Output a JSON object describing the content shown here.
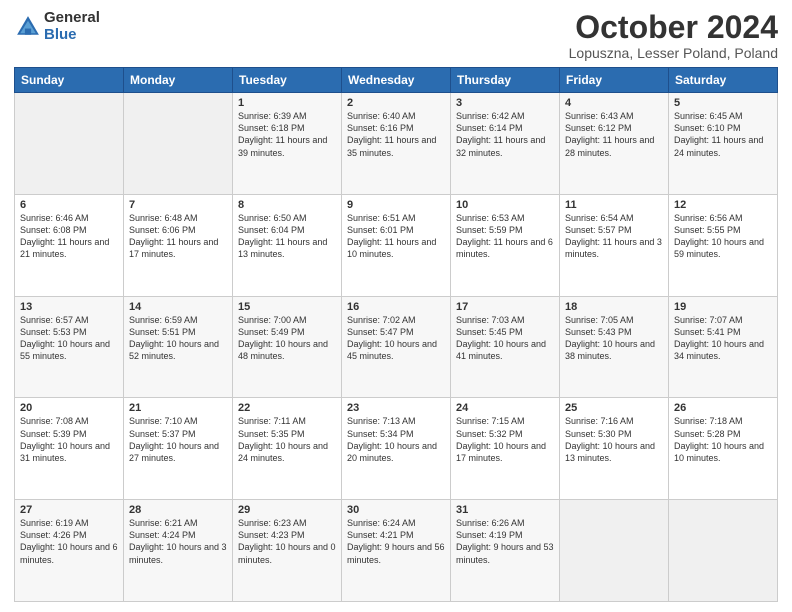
{
  "logo": {
    "general": "General",
    "blue": "Blue"
  },
  "header": {
    "title": "October 2024",
    "subtitle": "Lopuszna, Lesser Poland, Poland"
  },
  "columns": [
    "Sunday",
    "Monday",
    "Tuesday",
    "Wednesday",
    "Thursday",
    "Friday",
    "Saturday"
  ],
  "weeks": [
    [
      {
        "day": "",
        "sunrise": "",
        "sunset": "",
        "daylight": "",
        "empty": true
      },
      {
        "day": "",
        "sunrise": "",
        "sunset": "",
        "daylight": "",
        "empty": true
      },
      {
        "day": "1",
        "sunrise": "Sunrise: 6:39 AM",
        "sunset": "Sunset: 6:18 PM",
        "daylight": "Daylight: 11 hours and 39 minutes."
      },
      {
        "day": "2",
        "sunrise": "Sunrise: 6:40 AM",
        "sunset": "Sunset: 6:16 PM",
        "daylight": "Daylight: 11 hours and 35 minutes."
      },
      {
        "day": "3",
        "sunrise": "Sunrise: 6:42 AM",
        "sunset": "Sunset: 6:14 PM",
        "daylight": "Daylight: 11 hours and 32 minutes."
      },
      {
        "day": "4",
        "sunrise": "Sunrise: 6:43 AM",
        "sunset": "Sunset: 6:12 PM",
        "daylight": "Daylight: 11 hours and 28 minutes."
      },
      {
        "day": "5",
        "sunrise": "Sunrise: 6:45 AM",
        "sunset": "Sunset: 6:10 PM",
        "daylight": "Daylight: 11 hours and 24 minutes."
      }
    ],
    [
      {
        "day": "6",
        "sunrise": "Sunrise: 6:46 AM",
        "sunset": "Sunset: 6:08 PM",
        "daylight": "Daylight: 11 hours and 21 minutes."
      },
      {
        "day": "7",
        "sunrise": "Sunrise: 6:48 AM",
        "sunset": "Sunset: 6:06 PM",
        "daylight": "Daylight: 11 hours and 17 minutes."
      },
      {
        "day": "8",
        "sunrise": "Sunrise: 6:50 AM",
        "sunset": "Sunset: 6:04 PM",
        "daylight": "Daylight: 11 hours and 13 minutes."
      },
      {
        "day": "9",
        "sunrise": "Sunrise: 6:51 AM",
        "sunset": "Sunset: 6:01 PM",
        "daylight": "Daylight: 11 hours and 10 minutes."
      },
      {
        "day": "10",
        "sunrise": "Sunrise: 6:53 AM",
        "sunset": "Sunset: 5:59 PM",
        "daylight": "Daylight: 11 hours and 6 minutes."
      },
      {
        "day": "11",
        "sunrise": "Sunrise: 6:54 AM",
        "sunset": "Sunset: 5:57 PM",
        "daylight": "Daylight: 11 hours and 3 minutes."
      },
      {
        "day": "12",
        "sunrise": "Sunrise: 6:56 AM",
        "sunset": "Sunset: 5:55 PM",
        "daylight": "Daylight: 10 hours and 59 minutes."
      }
    ],
    [
      {
        "day": "13",
        "sunrise": "Sunrise: 6:57 AM",
        "sunset": "Sunset: 5:53 PM",
        "daylight": "Daylight: 10 hours and 55 minutes."
      },
      {
        "day": "14",
        "sunrise": "Sunrise: 6:59 AM",
        "sunset": "Sunset: 5:51 PM",
        "daylight": "Daylight: 10 hours and 52 minutes."
      },
      {
        "day": "15",
        "sunrise": "Sunrise: 7:00 AM",
        "sunset": "Sunset: 5:49 PM",
        "daylight": "Daylight: 10 hours and 48 minutes."
      },
      {
        "day": "16",
        "sunrise": "Sunrise: 7:02 AM",
        "sunset": "Sunset: 5:47 PM",
        "daylight": "Daylight: 10 hours and 45 minutes."
      },
      {
        "day": "17",
        "sunrise": "Sunrise: 7:03 AM",
        "sunset": "Sunset: 5:45 PM",
        "daylight": "Daylight: 10 hours and 41 minutes."
      },
      {
        "day": "18",
        "sunrise": "Sunrise: 7:05 AM",
        "sunset": "Sunset: 5:43 PM",
        "daylight": "Daylight: 10 hours and 38 minutes."
      },
      {
        "day": "19",
        "sunrise": "Sunrise: 7:07 AM",
        "sunset": "Sunset: 5:41 PM",
        "daylight": "Daylight: 10 hours and 34 minutes."
      }
    ],
    [
      {
        "day": "20",
        "sunrise": "Sunrise: 7:08 AM",
        "sunset": "Sunset: 5:39 PM",
        "daylight": "Daylight: 10 hours and 31 minutes."
      },
      {
        "day": "21",
        "sunrise": "Sunrise: 7:10 AM",
        "sunset": "Sunset: 5:37 PM",
        "daylight": "Daylight: 10 hours and 27 minutes."
      },
      {
        "day": "22",
        "sunrise": "Sunrise: 7:11 AM",
        "sunset": "Sunset: 5:35 PM",
        "daylight": "Daylight: 10 hours and 24 minutes."
      },
      {
        "day": "23",
        "sunrise": "Sunrise: 7:13 AM",
        "sunset": "Sunset: 5:34 PM",
        "daylight": "Daylight: 10 hours and 20 minutes."
      },
      {
        "day": "24",
        "sunrise": "Sunrise: 7:15 AM",
        "sunset": "Sunset: 5:32 PM",
        "daylight": "Daylight: 10 hours and 17 minutes."
      },
      {
        "day": "25",
        "sunrise": "Sunrise: 7:16 AM",
        "sunset": "Sunset: 5:30 PM",
        "daylight": "Daylight: 10 hours and 13 minutes."
      },
      {
        "day": "26",
        "sunrise": "Sunrise: 7:18 AM",
        "sunset": "Sunset: 5:28 PM",
        "daylight": "Daylight: 10 hours and 10 minutes."
      }
    ],
    [
      {
        "day": "27",
        "sunrise": "Sunrise: 6:19 AM",
        "sunset": "Sunset: 4:26 PM",
        "daylight": "Daylight: 10 hours and 6 minutes."
      },
      {
        "day": "28",
        "sunrise": "Sunrise: 6:21 AM",
        "sunset": "Sunset: 4:24 PM",
        "daylight": "Daylight: 10 hours and 3 minutes."
      },
      {
        "day": "29",
        "sunrise": "Sunrise: 6:23 AM",
        "sunset": "Sunset: 4:23 PM",
        "daylight": "Daylight: 10 hours and 0 minutes."
      },
      {
        "day": "30",
        "sunrise": "Sunrise: 6:24 AM",
        "sunset": "Sunset: 4:21 PM",
        "daylight": "Daylight: 9 hours and 56 minutes."
      },
      {
        "day": "31",
        "sunrise": "Sunrise: 6:26 AM",
        "sunset": "Sunset: 4:19 PM",
        "daylight": "Daylight: 9 hours and 53 minutes."
      },
      {
        "day": "",
        "sunrise": "",
        "sunset": "",
        "daylight": "",
        "empty": true
      },
      {
        "day": "",
        "sunrise": "",
        "sunset": "",
        "daylight": "",
        "empty": true
      }
    ]
  ]
}
